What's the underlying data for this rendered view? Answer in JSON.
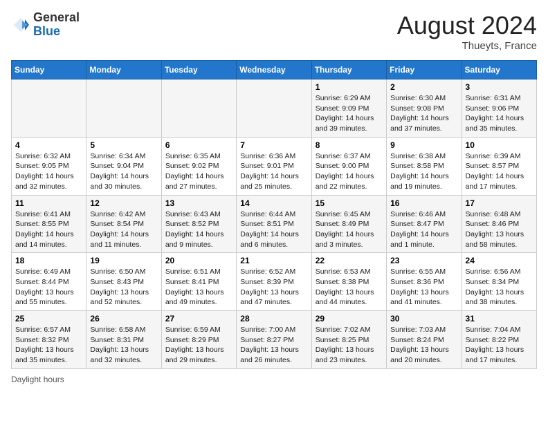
{
  "header": {
    "logo_general": "General",
    "logo_blue": "Blue",
    "month_year": "August 2024",
    "location": "Thueyts, France"
  },
  "days_of_week": [
    "Sunday",
    "Monday",
    "Tuesday",
    "Wednesday",
    "Thursday",
    "Friday",
    "Saturday"
  ],
  "footer": {
    "daylight_label": "Daylight hours"
  },
  "weeks": [
    [
      {
        "day": "",
        "info": ""
      },
      {
        "day": "",
        "info": ""
      },
      {
        "day": "",
        "info": ""
      },
      {
        "day": "",
        "info": ""
      },
      {
        "day": "1",
        "info": "Sunrise: 6:29 AM\nSunset: 9:09 PM\nDaylight: 14 hours and 39 minutes."
      },
      {
        "day": "2",
        "info": "Sunrise: 6:30 AM\nSunset: 9:08 PM\nDaylight: 14 hours and 37 minutes."
      },
      {
        "day": "3",
        "info": "Sunrise: 6:31 AM\nSunset: 9:06 PM\nDaylight: 14 hours and 35 minutes."
      }
    ],
    [
      {
        "day": "4",
        "info": "Sunrise: 6:32 AM\nSunset: 9:05 PM\nDaylight: 14 hours and 32 minutes."
      },
      {
        "day": "5",
        "info": "Sunrise: 6:34 AM\nSunset: 9:04 PM\nDaylight: 14 hours and 30 minutes."
      },
      {
        "day": "6",
        "info": "Sunrise: 6:35 AM\nSunset: 9:02 PM\nDaylight: 14 hours and 27 minutes."
      },
      {
        "day": "7",
        "info": "Sunrise: 6:36 AM\nSunset: 9:01 PM\nDaylight: 14 hours and 25 minutes."
      },
      {
        "day": "8",
        "info": "Sunrise: 6:37 AM\nSunset: 9:00 PM\nDaylight: 14 hours and 22 minutes."
      },
      {
        "day": "9",
        "info": "Sunrise: 6:38 AM\nSunset: 8:58 PM\nDaylight: 14 hours and 19 minutes."
      },
      {
        "day": "10",
        "info": "Sunrise: 6:39 AM\nSunset: 8:57 PM\nDaylight: 14 hours and 17 minutes."
      }
    ],
    [
      {
        "day": "11",
        "info": "Sunrise: 6:41 AM\nSunset: 8:55 PM\nDaylight: 14 hours and 14 minutes."
      },
      {
        "day": "12",
        "info": "Sunrise: 6:42 AM\nSunset: 8:54 PM\nDaylight: 14 hours and 11 minutes."
      },
      {
        "day": "13",
        "info": "Sunrise: 6:43 AM\nSunset: 8:52 PM\nDaylight: 14 hours and 9 minutes."
      },
      {
        "day": "14",
        "info": "Sunrise: 6:44 AM\nSunset: 8:51 PM\nDaylight: 14 hours and 6 minutes."
      },
      {
        "day": "15",
        "info": "Sunrise: 6:45 AM\nSunset: 8:49 PM\nDaylight: 14 hours and 3 minutes."
      },
      {
        "day": "16",
        "info": "Sunrise: 6:46 AM\nSunset: 8:47 PM\nDaylight: 14 hours and 1 minute."
      },
      {
        "day": "17",
        "info": "Sunrise: 6:48 AM\nSunset: 8:46 PM\nDaylight: 13 hours and 58 minutes."
      }
    ],
    [
      {
        "day": "18",
        "info": "Sunrise: 6:49 AM\nSunset: 8:44 PM\nDaylight: 13 hours and 55 minutes."
      },
      {
        "day": "19",
        "info": "Sunrise: 6:50 AM\nSunset: 8:43 PM\nDaylight: 13 hours and 52 minutes."
      },
      {
        "day": "20",
        "info": "Sunrise: 6:51 AM\nSunset: 8:41 PM\nDaylight: 13 hours and 49 minutes."
      },
      {
        "day": "21",
        "info": "Sunrise: 6:52 AM\nSunset: 8:39 PM\nDaylight: 13 hours and 47 minutes."
      },
      {
        "day": "22",
        "info": "Sunrise: 6:53 AM\nSunset: 8:38 PM\nDaylight: 13 hours and 44 minutes."
      },
      {
        "day": "23",
        "info": "Sunrise: 6:55 AM\nSunset: 8:36 PM\nDaylight: 13 hours and 41 minutes."
      },
      {
        "day": "24",
        "info": "Sunrise: 6:56 AM\nSunset: 8:34 PM\nDaylight: 13 hours and 38 minutes."
      }
    ],
    [
      {
        "day": "25",
        "info": "Sunrise: 6:57 AM\nSunset: 8:32 PM\nDaylight: 13 hours and 35 minutes."
      },
      {
        "day": "26",
        "info": "Sunrise: 6:58 AM\nSunset: 8:31 PM\nDaylight: 13 hours and 32 minutes."
      },
      {
        "day": "27",
        "info": "Sunrise: 6:59 AM\nSunset: 8:29 PM\nDaylight: 13 hours and 29 minutes."
      },
      {
        "day": "28",
        "info": "Sunrise: 7:00 AM\nSunset: 8:27 PM\nDaylight: 13 hours and 26 minutes."
      },
      {
        "day": "29",
        "info": "Sunrise: 7:02 AM\nSunset: 8:25 PM\nDaylight: 13 hours and 23 minutes."
      },
      {
        "day": "30",
        "info": "Sunrise: 7:03 AM\nSunset: 8:24 PM\nDaylight: 13 hours and 20 minutes."
      },
      {
        "day": "31",
        "info": "Sunrise: 7:04 AM\nSunset: 8:22 PM\nDaylight: 13 hours and 17 minutes."
      }
    ]
  ]
}
